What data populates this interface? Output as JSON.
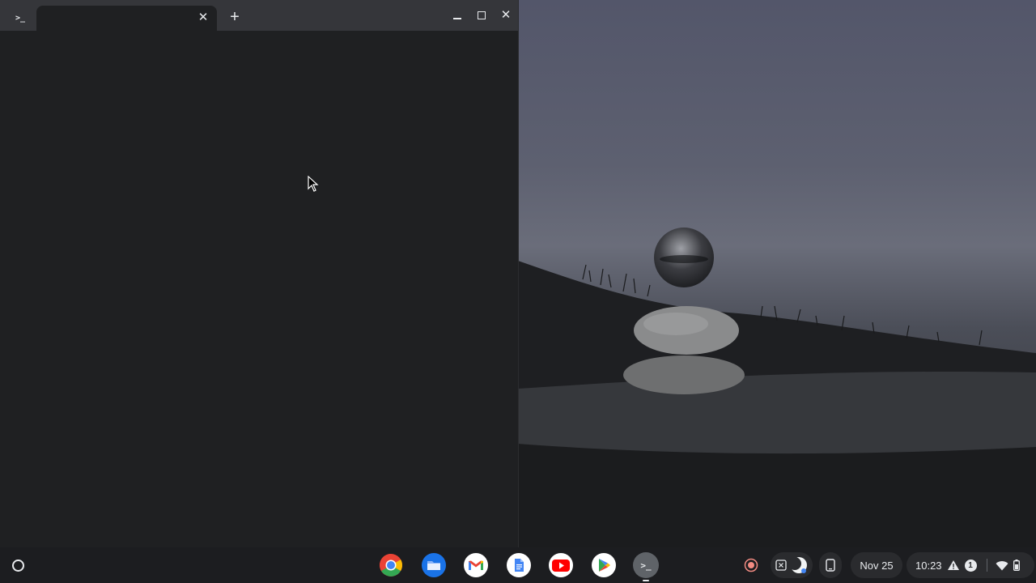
{
  "terminal": {
    "app_icon": ">_",
    "tab": {
      "title": "",
      "close_glyph": "✕"
    },
    "new_tab_glyph": "+",
    "controls": {
      "close_glyph": "✕"
    }
  },
  "shelf": {
    "apps": [
      {
        "name": "Chrome",
        "icon": "chrome-icon"
      },
      {
        "name": "Files",
        "icon": "files-icon"
      },
      {
        "name": "Gmail",
        "icon": "gmail-icon"
      },
      {
        "name": "Docs",
        "icon": "docs-icon"
      },
      {
        "name": "YouTube",
        "icon": "youtube-icon"
      },
      {
        "name": "Play Store",
        "icon": "play-store-icon"
      },
      {
        "name": "Terminal",
        "icon": "terminal-icon",
        "label": ">_"
      }
    ],
    "date": "Nov 25",
    "time": "10:23",
    "notification_count": "1"
  },
  "colors": {
    "shelf_bg": "#1c1d20",
    "window_bg": "#1f2022",
    "titlebar_bg": "#35363a",
    "chrome_red": "#ea4335",
    "chrome_green": "#34a853",
    "chrome_yellow": "#fbbc04",
    "chrome_blue": "#4285f4",
    "files_blue": "#1a73e8",
    "youtube_red": "#ff0000",
    "record_red": "#f28b82"
  }
}
